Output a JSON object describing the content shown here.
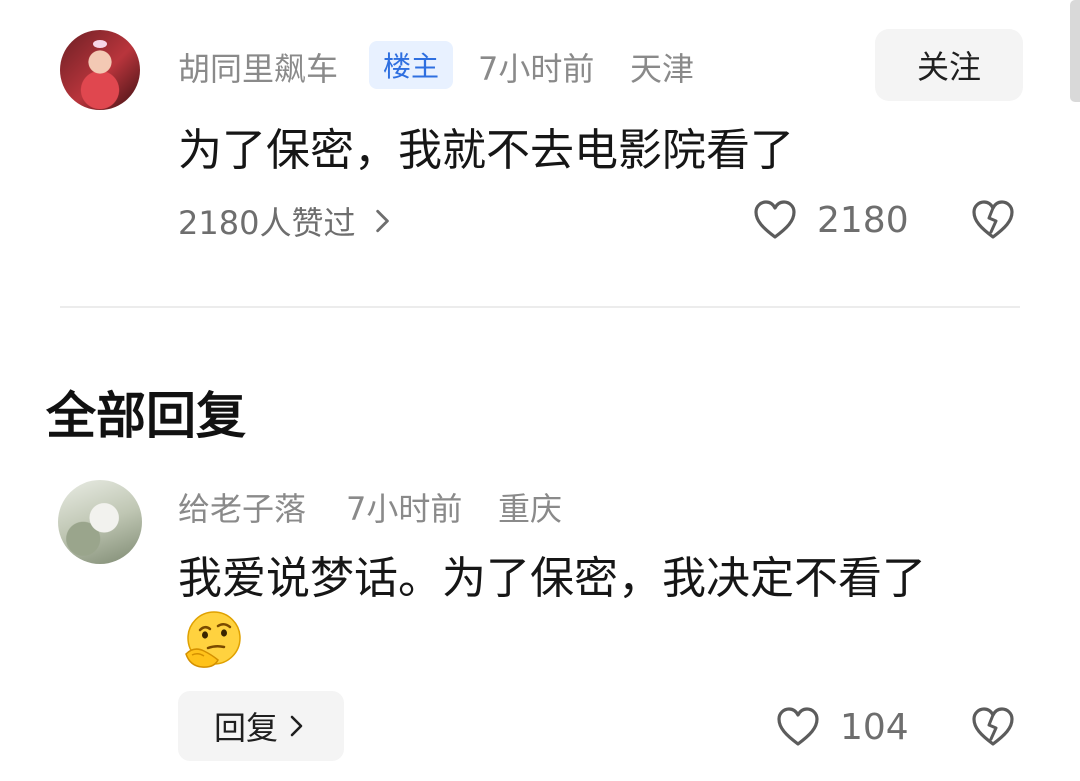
{
  "main_comment": {
    "author": "胡同里飙车",
    "badge": "楼主",
    "time": "7小时前",
    "location": "天津",
    "follow_label": "关注",
    "text": "为了保密，我就不去电影院看了",
    "liked_by": "2180人赞过",
    "like_count": "2180",
    "icons": {
      "avatar": "avatar-baby-photo",
      "liked_by_arrow": "chevron-right-icon",
      "like": "heart-icon",
      "dislike": "broken-heart-icon"
    }
  },
  "section": {
    "title": "全部回复"
  },
  "reply": {
    "author": "给老子落",
    "time": "7小时前",
    "location": "重庆",
    "text": "我爱说梦话。为了保密，我决定不看了",
    "emoji": "thinking-face-emoji",
    "reply_label": "回复",
    "like_count": "104",
    "icons": {
      "avatar": "avatar-goat-painting",
      "reply_arrow": "chevron-right-icon",
      "like": "heart-icon",
      "dislike": "broken-heart-icon"
    }
  },
  "colors": {
    "badge_bg": "#e8f1ff",
    "badge_text": "#2e6fe0",
    "muted_text": "#8a8a8a",
    "button_bg": "#f4f4f4"
  }
}
